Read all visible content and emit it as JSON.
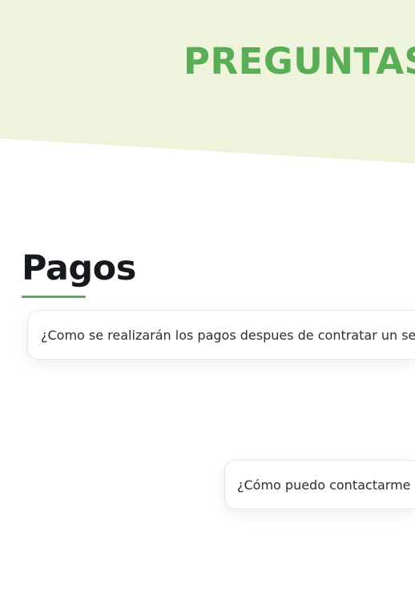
{
  "hero": {
    "title": "PREGUNTAS FRECUENTES"
  },
  "sections": [
    {
      "title": "Pagos",
      "questions": [
        {
          "text": "¿Como se realizarán los pagos despues de contratar un servicio?"
        }
      ]
    }
  ],
  "other_questions": [
    {
      "text": "¿Cómo puedo contactarme con ustedes?"
    }
  ],
  "colors": {
    "accent": "#5aad56",
    "hero_background": "#eef4dc",
    "heading": "#161a1f",
    "text": "#2b2f33",
    "card_border": "#e4e6e8"
  }
}
